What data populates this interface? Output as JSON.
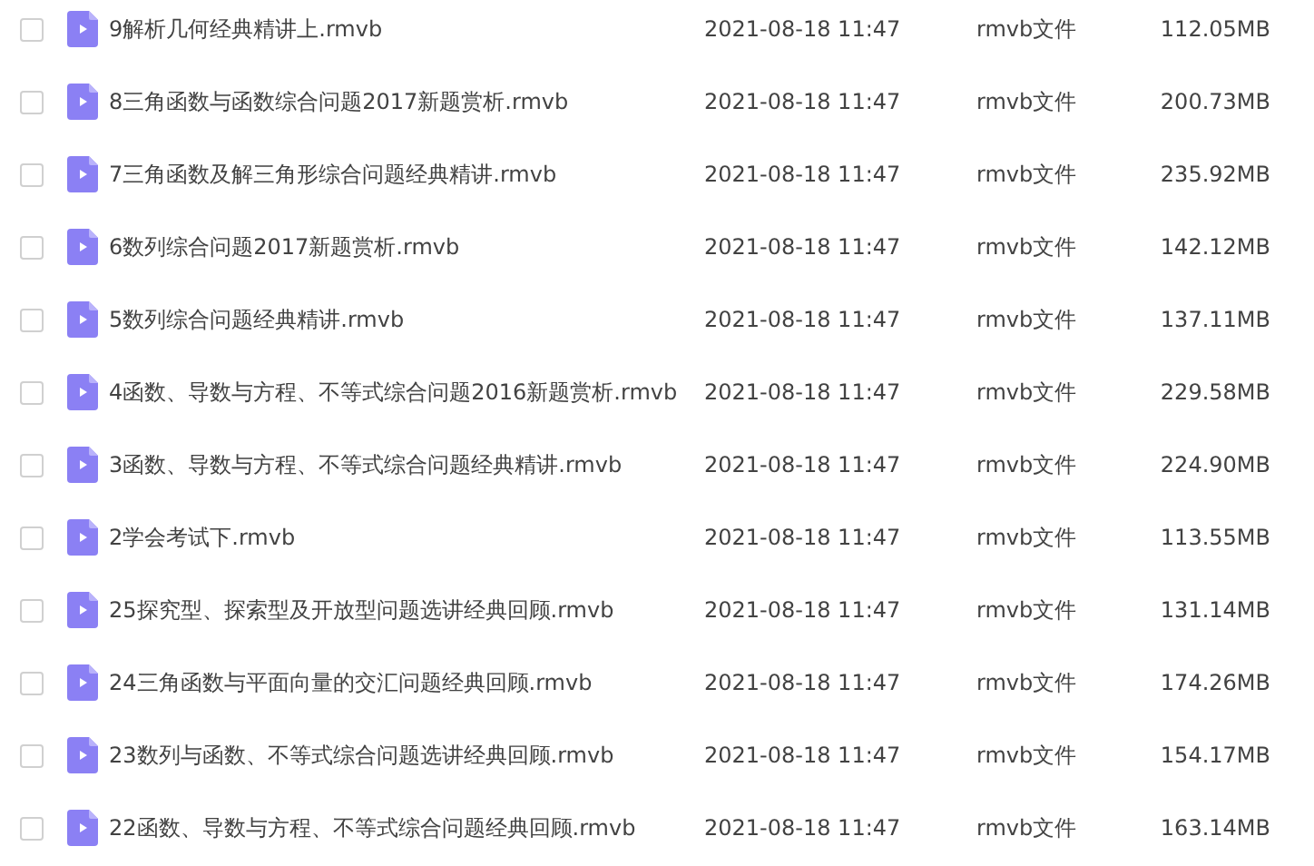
{
  "files": [
    {
      "name": "9解析几何经典精讲上.rmvb",
      "date": "2021-08-18 11:47",
      "type": "rmvb文件",
      "size": "112.05MB",
      "checked": false
    },
    {
      "name": "8三角函数与函数综合问题2017新题赏析.rmvb",
      "date": "2021-08-18 11:47",
      "type": "rmvb文件",
      "size": "200.73MB",
      "checked": false
    },
    {
      "name": "7三角函数及解三角形综合问题经典精讲.rmvb",
      "date": "2021-08-18 11:47",
      "type": "rmvb文件",
      "size": "235.92MB",
      "checked": false
    },
    {
      "name": "6数列综合问题2017新题赏析.rmvb",
      "date": "2021-08-18 11:47",
      "type": "rmvb文件",
      "size": "142.12MB",
      "checked": false
    },
    {
      "name": "5数列综合问题经典精讲.rmvb",
      "date": "2021-08-18 11:47",
      "type": "rmvb文件",
      "size": "137.11MB",
      "checked": false
    },
    {
      "name": "4函数、导数与方程、不等式综合问题2016新题赏析.rmvb",
      "date": "2021-08-18 11:47",
      "type": "rmvb文件",
      "size": "229.58MB",
      "checked": false
    },
    {
      "name": "3函数、导数与方程、不等式综合问题经典精讲.rmvb",
      "date": "2021-08-18 11:47",
      "type": "rmvb文件",
      "size": "224.90MB",
      "checked": false
    },
    {
      "name": "2学会考试下.rmvb",
      "date": "2021-08-18 11:47",
      "type": "rmvb文件",
      "size": "113.55MB",
      "checked": false
    },
    {
      "name": "25探究型、探索型及开放型问题选讲经典回顾.rmvb",
      "date": "2021-08-18 11:47",
      "type": "rmvb文件",
      "size": "131.14MB",
      "checked": false
    },
    {
      "name": "24三角函数与平面向量的交汇问题经典回顾.rmvb",
      "date": "2021-08-18 11:47",
      "type": "rmvb文件",
      "size": "174.26MB",
      "checked": false
    },
    {
      "name": "23数列与函数、不等式综合问题选讲经典回顾.rmvb",
      "date": "2021-08-18 11:47",
      "type": "rmvb文件",
      "size": "154.17MB",
      "checked": false
    },
    {
      "name": "22函数、导数与方程、不等式综合问题经典回顾.rmvb",
      "date": "2021-08-18 11:47",
      "type": "rmvb文件",
      "size": "163.14MB",
      "checked": false
    }
  ]
}
